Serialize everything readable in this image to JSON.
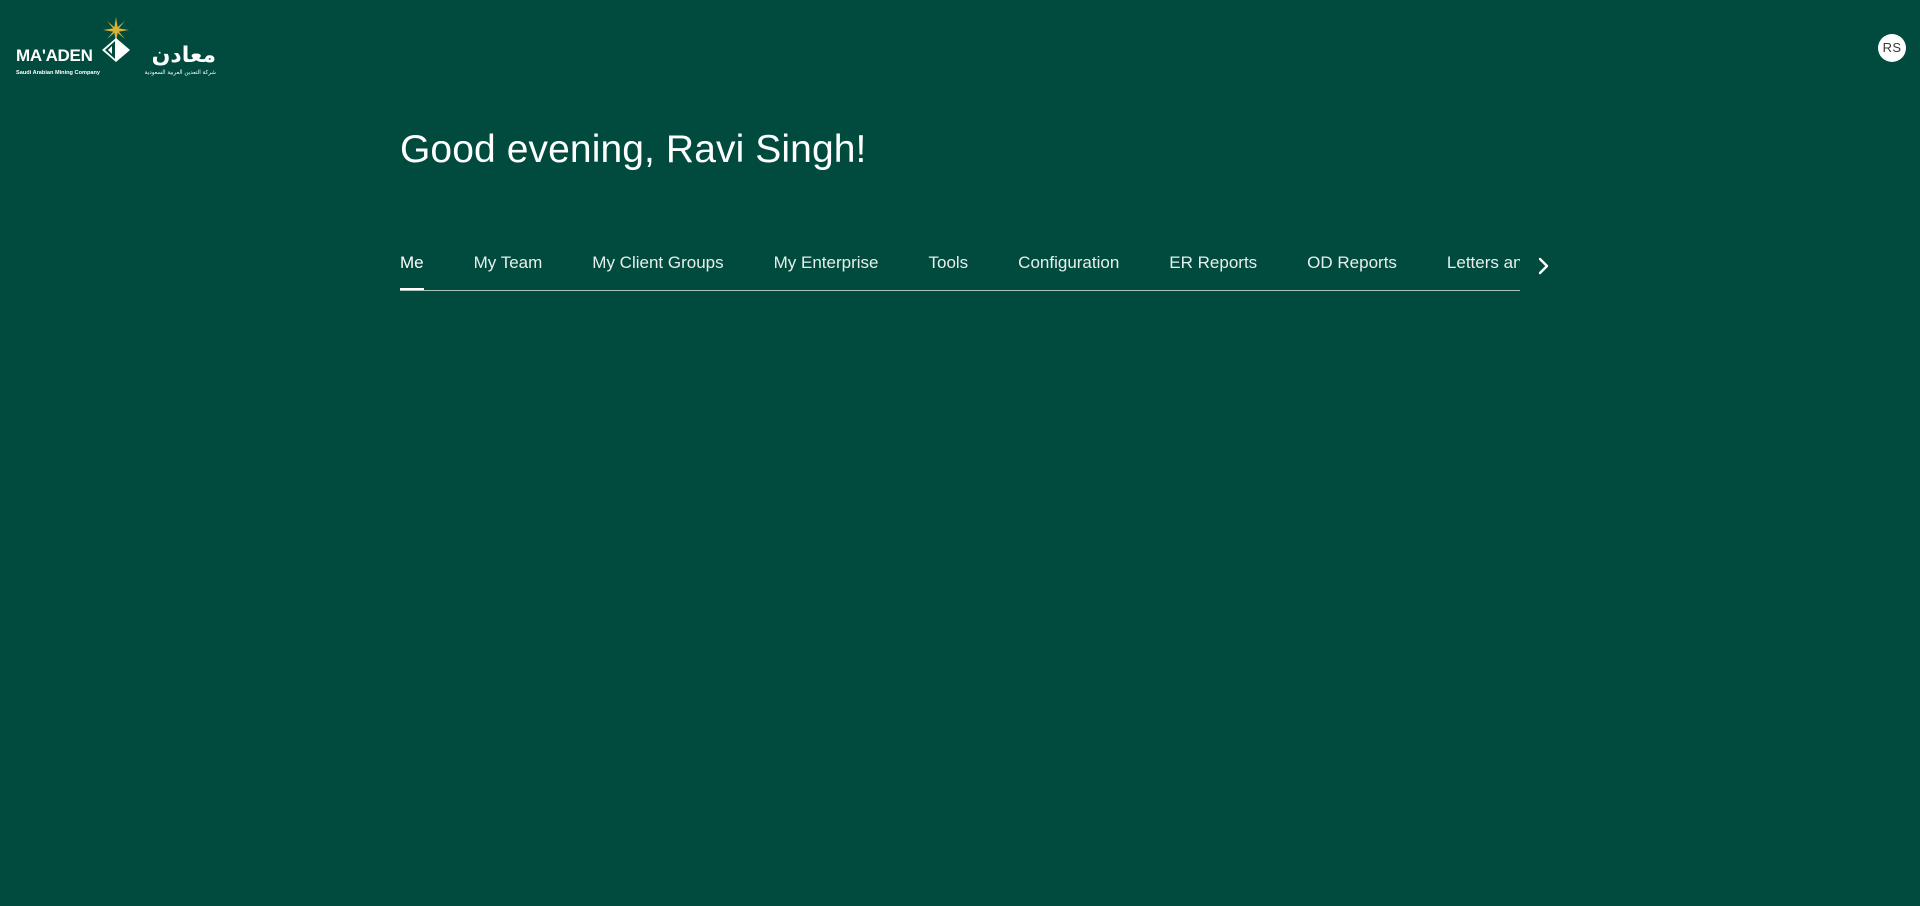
{
  "header": {
    "logo": {
      "wordmark_en": "MA'ADEN",
      "wordmark_ar": "معادن",
      "tagline_en": "Saudi Arabian Mining Company",
      "tagline_ar": "شركة التعدين العربية السعودية",
      "star_color": "#d8b33a"
    },
    "avatar_initials": "RS"
  },
  "greeting": "Good evening, Ravi Singh!",
  "tabs": [
    {
      "label": "Me",
      "active": true
    },
    {
      "label": "My Team",
      "active": false
    },
    {
      "label": "My Client Groups",
      "active": false
    },
    {
      "label": "My Enterprise",
      "active": false
    },
    {
      "label": "Tools",
      "active": false
    },
    {
      "label": "Configuration",
      "active": false
    },
    {
      "label": "ER Reports",
      "active": false
    },
    {
      "label": "OD Reports",
      "active": false
    },
    {
      "label": "Letters and",
      "active": false
    }
  ],
  "icons": {
    "scroll_right": "chevron-right-icon"
  },
  "colors": {
    "background": "#004b3d",
    "text": "#ffffff",
    "tab_divider": "#a9c4bd"
  }
}
